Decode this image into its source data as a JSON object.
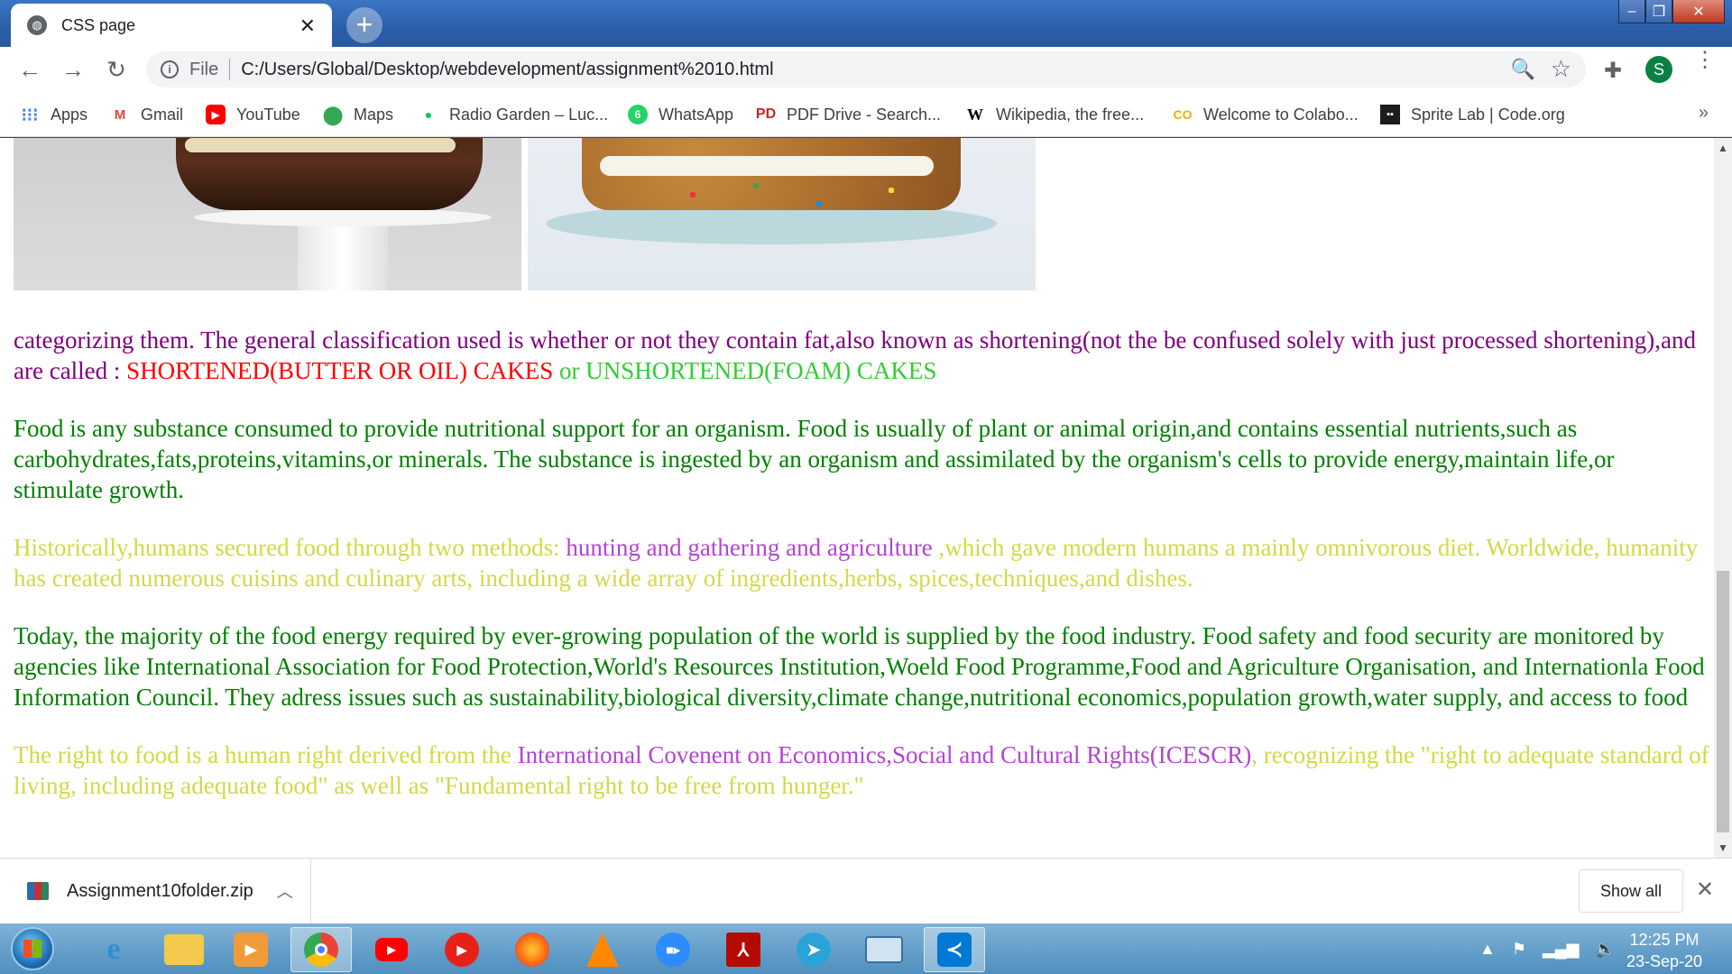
{
  "browser": {
    "tab_title": "CSS page",
    "address_scheme": "File",
    "address_url": "C:/Users/Global/Desktop/webdevelopment/assignment%2010.html",
    "profile_initial": "S"
  },
  "bookmarks": [
    {
      "label": "Apps",
      "icon": "apps-grid-icon",
      "color": "#4285f4"
    },
    {
      "label": "Gmail",
      "icon": "gmail-icon",
      "color": "#ea4335"
    },
    {
      "label": "YouTube",
      "icon": "youtube-icon",
      "color": "#ff0000"
    },
    {
      "label": "Maps",
      "icon": "maps-pin-icon",
      "color": "#34a853"
    },
    {
      "label": "Radio Garden – Luc...",
      "icon": "radio-garden-icon",
      "color": "#00c853"
    },
    {
      "label": "WhatsApp",
      "icon": "whatsapp-icon",
      "color": "#25d366"
    },
    {
      "label": "PDF Drive - Search...",
      "icon": "pdf-drive-icon",
      "color": "#c62828"
    },
    {
      "label": "Wikipedia, the free...",
      "icon": "wikipedia-icon",
      "color": "#000000"
    },
    {
      "label": "Welcome to Colabo...",
      "icon": "colab-icon",
      "color": "#f9ab00"
    },
    {
      "label": "Sprite Lab | Code.org",
      "icon": "code-org-icon",
      "color": "#1d1d1d"
    }
  ],
  "page": {
    "p1": {
      "a": "categorizing them. The general classification used is whether or not they contain fat,also known as shortening(not the be confused solely with just processed shortening),and are called : ",
      "b": "SHORTENED(BUTTER OR OIL) CAKES",
      "c": " or ",
      "d": "UNSHORTENED(FOAM) CAKES"
    },
    "p2": "Food is any substance consumed to provide nutritional support for an organism. Food is usually of plant or animal origin,and contains essential nutrients,such as carbohydrates,fats,proteins,vitamins,or minerals. The substance is ingested by an organism and assimilated by the organism's cells to provide energy,maintain life,or stimulate growth.",
    "p3": {
      "a": "Historically,humans secured food through two methods: ",
      "b": "hunting and gathering and agriculture",
      "c": " ,which gave modern humans a mainly omnivorous diet. Worldwide, humanity has created numerous cuisins and culinary arts, including a wide array of ingredients,herbs, spices,techniques,and dishes."
    },
    "p4": "Today, the majority of the food energy required by ever-growing population of the world is supplied by the food industry. Food safety and food security are monitored by agencies like International Association for Food Protection,World's Resources Institution,Woeld Food Programme,Food and Agriculture Organisation, and Internationla Food Information Council. They adress issues such as sustainability,biological diversity,climate change,nutritional economics,population growth,water supply, and access to food",
    "p5": {
      "a": "The right to food is a human right derived from the ",
      "b": "International Covenent on Economics,Social and Cultural Rights(ICESCR)",
      "c": ", recognizing the \"right to adequate standard of living, including adequate food\" as well as \"Fundamental right to be free from hunger.\""
    }
  },
  "downloads": {
    "file_name": "Assignment10folder.zip",
    "show_all": "Show all"
  },
  "taskbar": {
    "time": "12:25 PM",
    "date": "23-Sep-20"
  },
  "colors": {
    "purple": "#800080",
    "red": "#ff0000",
    "lime": "#32cd32",
    "green": "#008000",
    "yellow": "#d4d846",
    "orchid": "#b543d3"
  }
}
